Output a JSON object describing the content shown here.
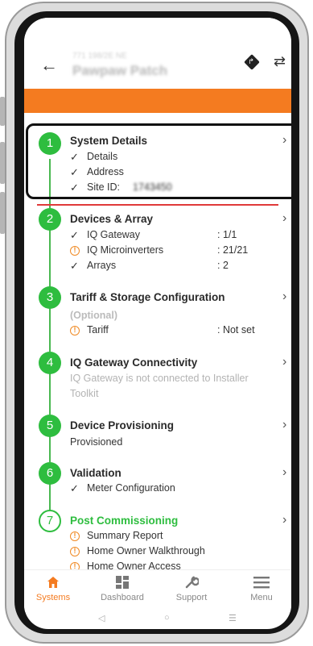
{
  "header": {
    "subtitle": "771 198/2E NE",
    "title": "Pawpaw Patch",
    "back_icon": "arrow-left-icon",
    "directions_icon": "directions-icon",
    "swap_icon": "swap-icon"
  },
  "colors": {
    "accent": "#f47b20",
    "step_green": "#2ebd3f",
    "warning": "#f08a24"
  },
  "steps": [
    {
      "number": "1",
      "title": "System Details",
      "items": [
        {
          "icon": "check",
          "label": "Details"
        },
        {
          "icon": "check",
          "label": "Address"
        },
        {
          "icon": "check",
          "label": "Site ID:",
          "value": "1743450"
        }
      ]
    },
    {
      "number": "2",
      "title": "Devices & Array",
      "items": [
        {
          "icon": "check",
          "label": "IQ Gateway",
          "value": ": 1/1"
        },
        {
          "icon": "warning",
          "label": "IQ Microinverters",
          "value": ": 21/21"
        },
        {
          "icon": "check",
          "label": "Arrays",
          "value": ": 2"
        }
      ]
    },
    {
      "number": "3",
      "title": "Tariff & Storage Configuration",
      "optional": "(Optional)",
      "items": [
        {
          "icon": "warning",
          "label": "Tariff",
          "value": ": Not set"
        }
      ]
    },
    {
      "number": "4",
      "title": "IQ Gateway Connectivity",
      "note": "IQ Gateway is not connected to Installer Toolkit"
    },
    {
      "number": "5",
      "title": "Device Provisioning",
      "status": "Provisioned"
    },
    {
      "number": "6",
      "title": "Validation",
      "items": [
        {
          "icon": "check",
          "label": "Meter Configuration"
        }
      ]
    },
    {
      "number": "7",
      "title": "Post Commissioning",
      "items": [
        {
          "icon": "warning",
          "label": "Summary Report"
        },
        {
          "icon": "warning",
          "label": "Home Owner Walkthrough"
        },
        {
          "icon": "warning",
          "label": "Home Owner Access"
        }
      ]
    }
  ],
  "bottom_nav": [
    {
      "label": "Systems",
      "icon": "home-icon",
      "active": true
    },
    {
      "label": "Dashboard",
      "icon": "dashboard-icon",
      "active": false
    },
    {
      "label": "Support",
      "icon": "wrench-icon",
      "active": false
    },
    {
      "label": "Menu",
      "icon": "menu-icon",
      "active": false
    }
  ],
  "system_nav": {
    "back": "◁",
    "home": "○",
    "recents": "☰"
  },
  "glyphs": {
    "check": "✓",
    "warning": "!",
    "chevron": "›",
    "back_arrow": "←",
    "swap": "⇄",
    "turn": "↱"
  }
}
